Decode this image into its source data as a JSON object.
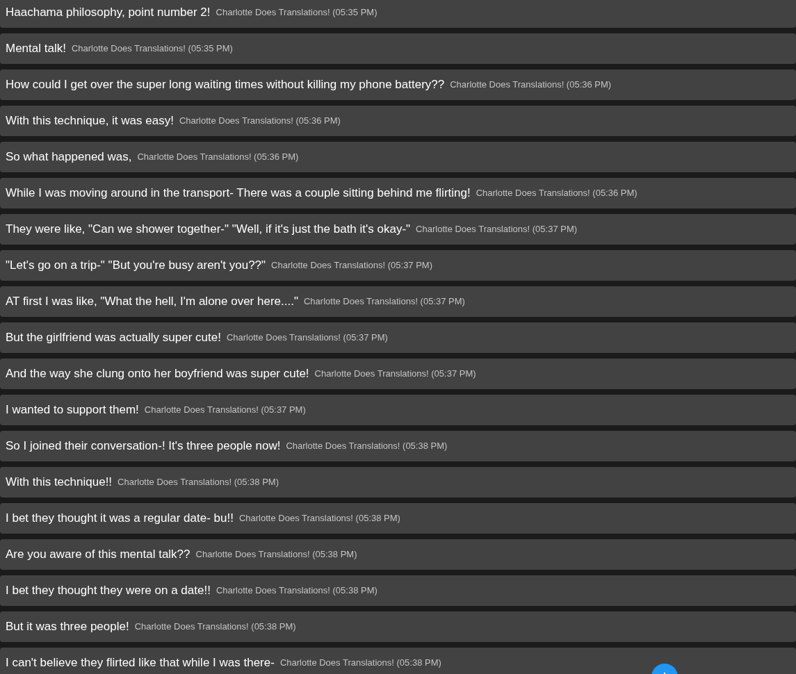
{
  "messages": [
    {
      "text": "Haachama philosophy, point number 2!",
      "author": "Charlotte Does Translations!",
      "time": "(05:35 PM)"
    },
    {
      "text": "Mental talk!",
      "author": "Charlotte Does Translations!",
      "time": "(05:35 PM)"
    },
    {
      "text": "How could I get over the super long waiting times without killing my phone battery??",
      "author": "Charlotte Does Translations!",
      "time": "(05:36 PM)"
    },
    {
      "text": "With this technique, it was easy!",
      "author": "Charlotte Does Translations!",
      "time": "(05:36 PM)"
    },
    {
      "text": "So what happened was,",
      "author": "Charlotte Does Translations!",
      "time": "(05:36 PM)"
    },
    {
      "text": "While I was moving around in the transport- There was a couple sitting behind me flirting!",
      "author": "Charlotte Does Translations!",
      "time": "(05:36 PM)"
    },
    {
      "text": "They were like, \"Can we shower together-\" \"Well, if it's just the bath it's okay-\"",
      "author": "Charlotte Does Translations!",
      "time": "(05:37 PM)"
    },
    {
      "text": "\"Let's go on a trip-\" \"But you're busy aren't you??\"",
      "author": "Charlotte Does Translations!",
      "time": "(05:37 PM)"
    },
    {
      "text": "AT first I was like, \"What the hell, I'm alone over here....\"",
      "author": "Charlotte Does Translations!",
      "time": "(05:37 PM)"
    },
    {
      "text": "But the girlfriend was actually super cute!",
      "author": "Charlotte Does Translations!",
      "time": "(05:37 PM)"
    },
    {
      "text": "And the way she clung onto her boyfriend was super cute!",
      "author": "Charlotte Does Translations!",
      "time": "(05:37 PM)"
    },
    {
      "text": "I wanted to support them!",
      "author": "Charlotte Does Translations!",
      "time": "(05:37 PM)"
    },
    {
      "text": "So I joined their conversation-! It's three people now!",
      "author": "Charlotte Does Translations!",
      "time": "(05:38 PM)"
    },
    {
      "text": "With this technique!!",
      "author": "Charlotte Does Translations!",
      "time": "(05:38 PM)"
    },
    {
      "text": "I bet they thought it was a regular date- bu!!",
      "author": "Charlotte Does Translations!",
      "time": "(05:38 PM)"
    },
    {
      "text": "Are you aware of this mental talk??",
      "author": "Charlotte Does Translations!",
      "time": "(05:38 PM)"
    },
    {
      "text": "I bet they thought they were on a date!!",
      "author": "Charlotte Does Translations!",
      "time": "(05:38 PM)"
    },
    {
      "text": "But it was three people!",
      "author": "Charlotte Does Translations!",
      "time": "(05:38 PM)"
    },
    {
      "text": "I can't believe they flirted like that while I was there-",
      "author": "Charlotte Does Translations!",
      "time": "(05:38 PM)"
    }
  ]
}
